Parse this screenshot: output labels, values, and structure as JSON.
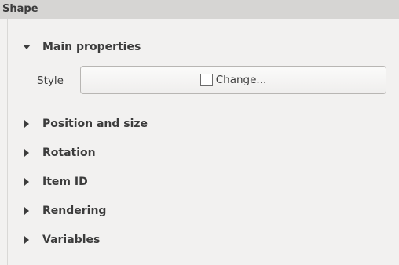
{
  "panel": {
    "title": "Shape"
  },
  "groups": {
    "main_properties": {
      "label": "Main properties",
      "expanded": true,
      "style_label": "Style",
      "style_button_label": "Change..."
    },
    "position_and_size": {
      "label": "Position and size",
      "expanded": false
    },
    "rotation": {
      "label": "Rotation",
      "expanded": false
    },
    "item_id": {
      "label": "Item ID",
      "expanded": false
    },
    "rendering": {
      "label": "Rendering",
      "expanded": false
    },
    "variables": {
      "label": "Variables",
      "expanded": false
    }
  },
  "icons": {
    "expanded_arrow": "triangle-down-icon",
    "collapsed_arrow": "triangle-right-icon"
  },
  "colors": {
    "title_bar_bg": "#d6d5d3",
    "panel_bg": "#f2f1f0",
    "text": "#3c3c3c"
  }
}
